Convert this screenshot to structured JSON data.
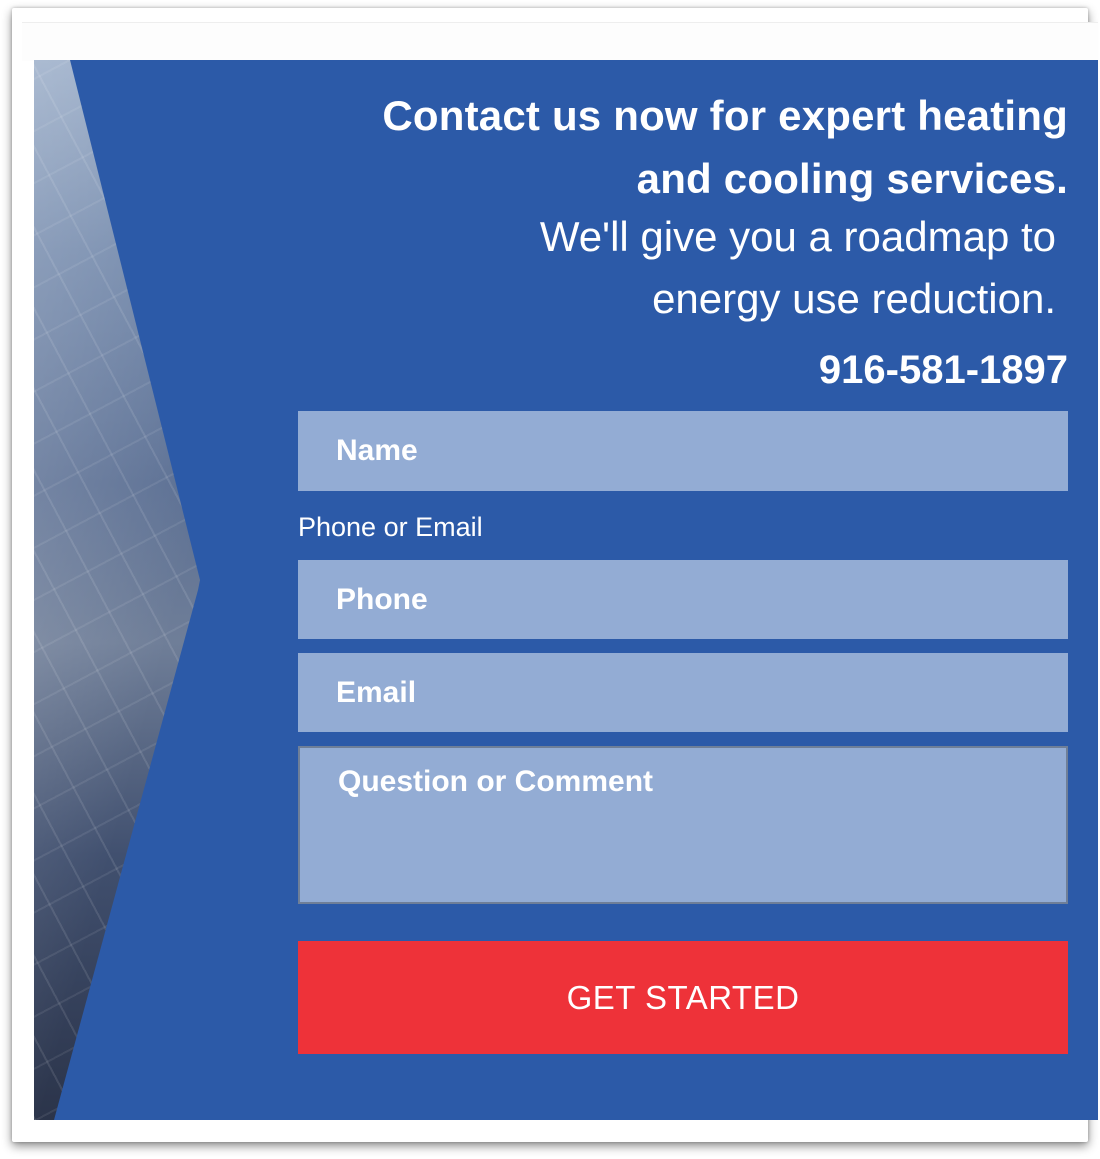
{
  "contact_panel": {
    "heading_line1": "Contact us now for expert heating",
    "heading_line2": "and cooling services.",
    "subheading_line1": "We'll give you a roadmap to",
    "subheading_line2": "energy use reduction.",
    "phone_number": "916-581-1897"
  },
  "form": {
    "name_placeholder": "Name",
    "contact_hint": "Phone or Email",
    "phone_placeholder": "Phone",
    "email_placeholder": "Email",
    "comment_placeholder": "Question or Comment",
    "submit_label": "GET STARTED"
  },
  "colors": {
    "panel_blue": "#2c5aa8",
    "field_blue": "#93acd4",
    "button_red": "#ee3239",
    "text_white": "#ffffff"
  },
  "icons": {
    "background_image": "solar-panel-photo"
  }
}
